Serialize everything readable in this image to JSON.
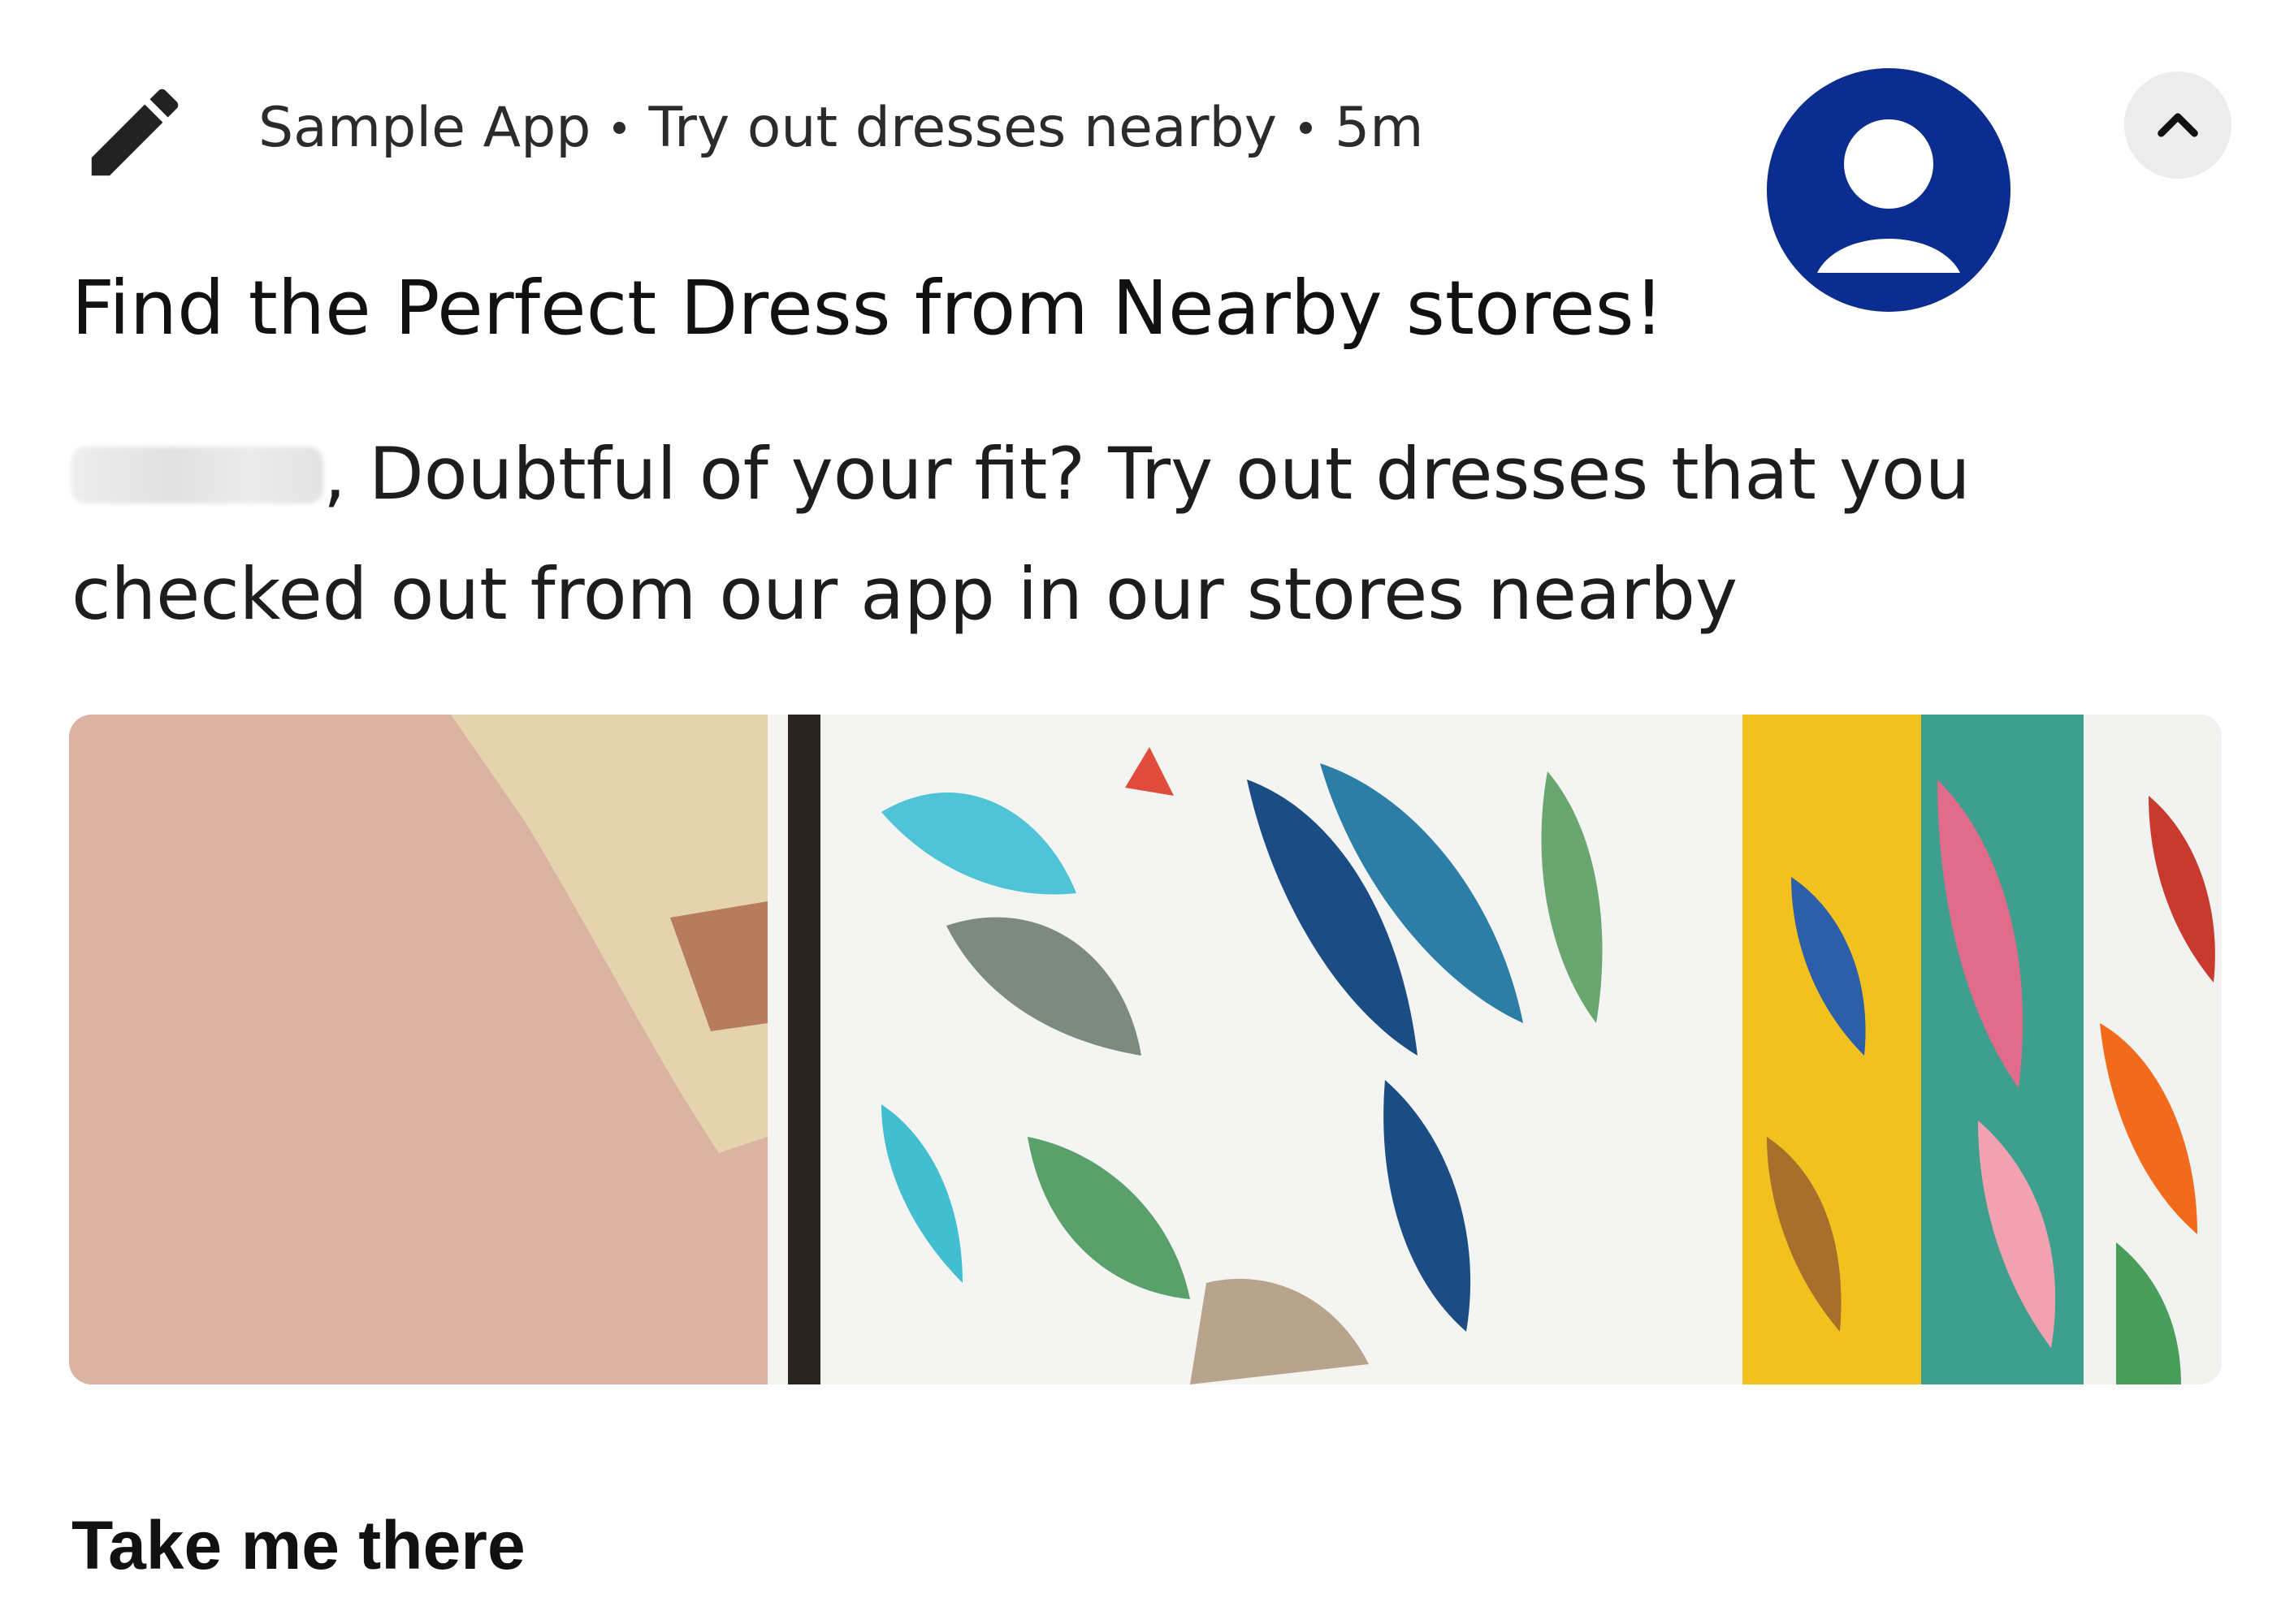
{
  "notification": {
    "app_name": "Sample App",
    "channel": "Try out dresses nearby",
    "time": "5m",
    "title": "Find the Perfect Dress from Nearby stores!",
    "message": ", Doubtful of your fit? Try out dresses that you checked out from our app in our stores nearby",
    "action_label": "Take me there"
  },
  "icons": {
    "app_icon": "pencil-icon",
    "avatar": "user-avatar-icon",
    "collapse": "chevron-up-icon"
  },
  "colors": {
    "avatar_blue": "#0b2d8f",
    "text": "#1a1a1a",
    "collapse_bg": "#ececec"
  }
}
